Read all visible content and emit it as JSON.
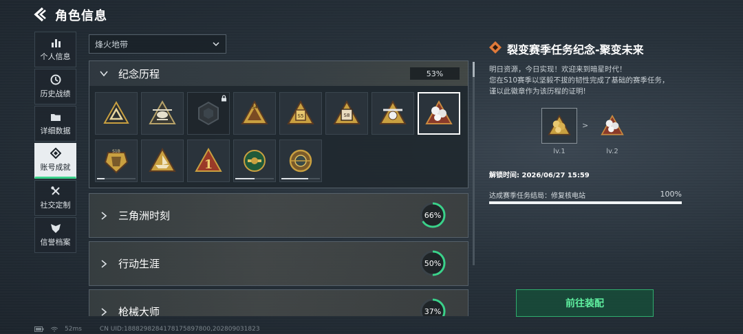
{
  "header": {
    "title": "角色信息"
  },
  "sidebar": {
    "items": [
      {
        "label": "个人信息",
        "icon": "bar-chart-icon"
      },
      {
        "label": "历史战绩",
        "icon": "history-clock-icon"
      },
      {
        "label": "详细数据",
        "icon": "folder-icon"
      },
      {
        "label": "账号成就",
        "icon": "achievement-icon"
      },
      {
        "label": "社交定制",
        "icon": "tools-icon"
      },
      {
        "label": "信誉档案",
        "icon": "shield-wing-icon"
      }
    ],
    "active_index": 3
  },
  "mode_select": {
    "value": "烽火地带"
  },
  "sections": {
    "memorial": {
      "name": "纪念历程",
      "percent": "53%"
    },
    "delta": {
      "name": "三角洲时刻",
      "percent": "66%",
      "progress": 0.66
    },
    "career": {
      "name": "行动生涯",
      "percent": "50%",
      "progress": 0.5
    },
    "gunmaster": {
      "name": "枪械大师",
      "percent": "37%",
      "progress": 0.37
    }
  },
  "badges": {
    "row1": [
      "triangle-a-badge",
      "helicopter-badge",
      "locked-hex-badge",
      "s4-badge",
      "s5-badge",
      "s8-badge",
      "satellite-badge",
      "fission-badge"
    ],
    "row2": [
      "s1b-badge",
      "boat-badge",
      "number-one-badge",
      "wreath-badge",
      "round-emblem-badge"
    ],
    "number_one_text": "1",
    "row2_progress": [
      0.2,
      0,
      0,
      0.5,
      0.7
    ],
    "selected_index": 7,
    "badge_texts": {
      "s4": "S4",
      "s5": "S5",
      "s8": "S8",
      "s1b": "S1B"
    }
  },
  "detail": {
    "title": "裂变赛季任务纪念-聚变未来",
    "desc_lines": [
      "明日资源，今日实现！欢迎来到暗星时代！",
      "您在S10赛季以坚毅不拔的韧性完成了基础的赛季任务，",
      "谨以此徽章作为该历程的证明!"
    ],
    "levels": [
      "lv.1",
      "lv.2"
    ],
    "arrow": ">",
    "unlock_time": "解锁时间: 2026/06/27 15:59",
    "task": {
      "label": "达成赛季任务结局：修复核电站",
      "value": "100%",
      "progress": 1.0
    },
    "equip_button": "前往装配"
  },
  "footer": {
    "ping": "52ms",
    "uid": "CN UID:1888298284178175897800,202809031823"
  },
  "colors": {
    "accent_green": "#3ad28a",
    "badge_gold": "#c9a040",
    "badge_dark": "#5a3a22",
    "ring_track": "#3a4248"
  }
}
